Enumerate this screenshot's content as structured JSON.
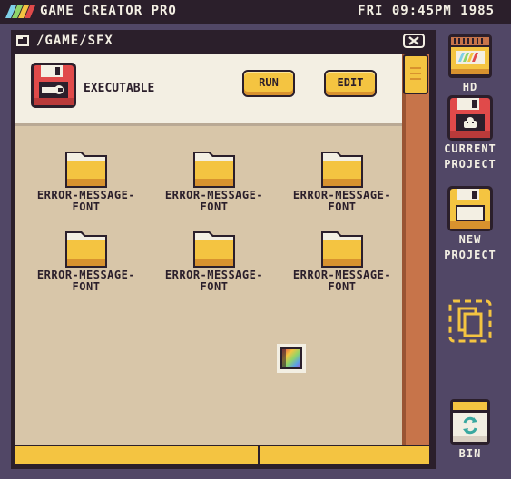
{
  "menubar": {
    "app_title": "GAME CREATOR PRO",
    "clock": "FRI 09:45PM 1985",
    "logo_icon": "rainbow-stripes-icon"
  },
  "window": {
    "path": "/GAME/SFX",
    "close_icon": "close-icon",
    "selected": {
      "label": "EXECUTABLE",
      "icon": "floppy-wrench-icon",
      "run_label": "RUN",
      "edit_label": "EDIT"
    },
    "files": [
      {
        "name_line1": "ERROR-MESSAGE-",
        "name_line2": "FONT"
      },
      {
        "name_line1": "ERROR-MESSAGE-",
        "name_line2": "FONT"
      },
      {
        "name_line1": "ERROR-MESSAGE-",
        "name_line2": "FONT"
      },
      {
        "name_line1": "ERROR-MESSAGE-",
        "name_line2": "FONT"
      },
      {
        "name_line1": "ERROR-MESSAGE-",
        "name_line2": "FONT"
      },
      {
        "name_line1": "ERROR-MESSAGE-",
        "name_line2": "FONT"
      }
    ],
    "palette_icon": "color-palette-icon"
  },
  "dock": {
    "hd_label": "HD",
    "current_line1": "CURRENT",
    "current_line2": "PROJECT",
    "new_line1": "NEW",
    "new_line2": "PROJECT",
    "bin_label": "BIN"
  },
  "colors": {
    "desktop": "#514766",
    "dark": "#2b1f2b",
    "cream": "#f3efe3",
    "yellow": "#f4c441",
    "orange": "#c7744a",
    "tan": "#d8c6a9",
    "red": "#e04a4a"
  }
}
